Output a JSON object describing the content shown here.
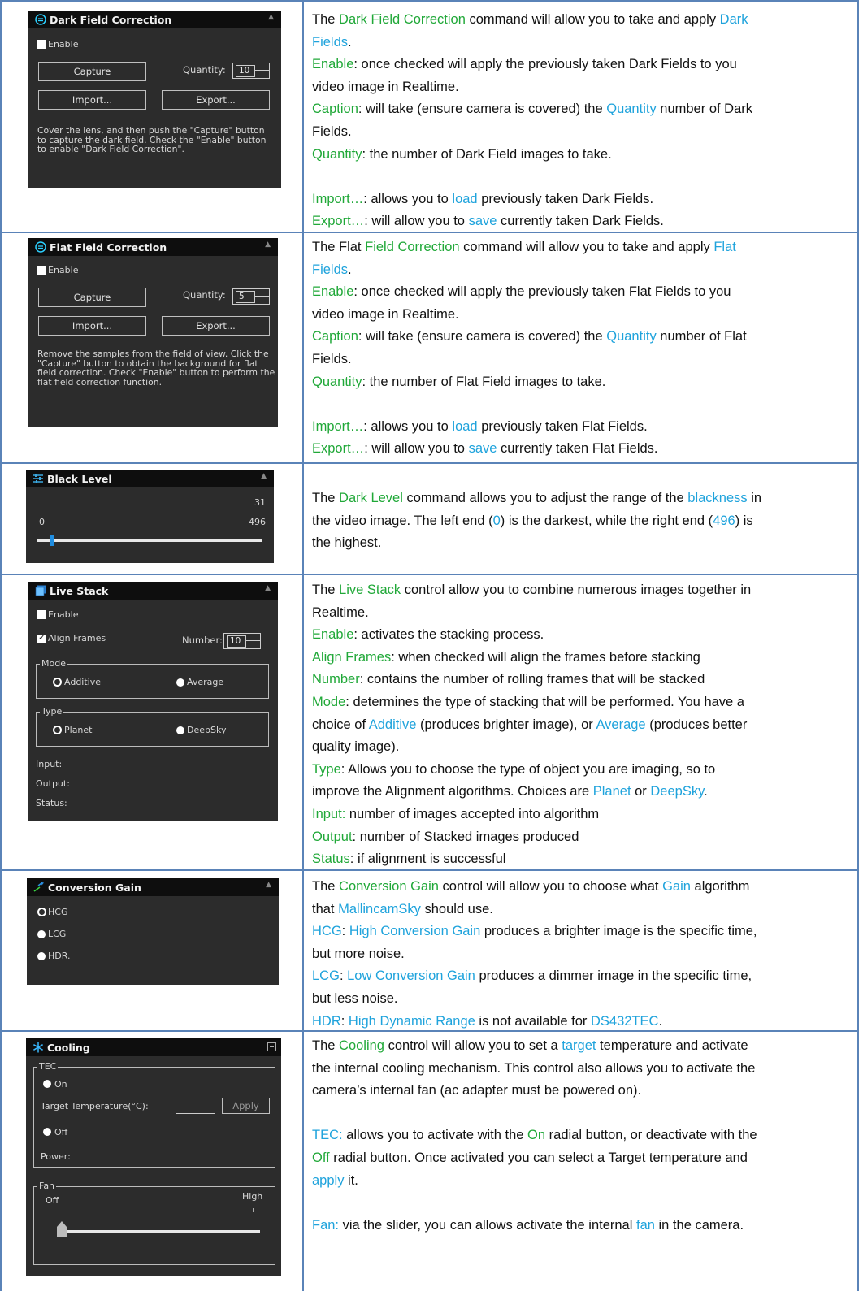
{
  "panels": {
    "dark": {
      "title": "Dark Field Correction",
      "enable_label": "Enable",
      "capture_label": "Capture",
      "quantity_label": "Quantity:",
      "quantity_value": "10",
      "import_label": "Import...",
      "export_label": "Export...",
      "help_lines": [
        "Cover the lens, and then push the \"Capture\" button",
        "to capture the dark field. Check the \"Enable\" button",
        "to enable \"Dark Field Correction\"."
      ]
    },
    "flat": {
      "title": "Flat Field Correction",
      "enable_label": "Enable",
      "capture_label": "Capture",
      "quantity_label": "Quantity:",
      "quantity_value": "5",
      "import_label": "Import...",
      "export_label": "Export...",
      "help_lines": [
        "Remove the samples from the field of view. Click the",
        "\"Capture\" button to obtain the background for flat",
        "field correction. Check \"Enable\" button to perform the",
        "flat field correction function."
      ]
    },
    "black": {
      "title": "Black Level",
      "current_value": "31",
      "min_label": "0",
      "max_label": "496",
      "level": 31
    },
    "stack": {
      "title": "Live Stack",
      "enable_label": "Enable",
      "align_label": "Align Frames",
      "number_label": "Number:",
      "number_value": "10",
      "mode_label": "Mode",
      "mode_opt1": "Additive",
      "mode_opt2": "Average",
      "type_label": "Type",
      "type_opt1": "Planet",
      "type_opt2": "DeepSky",
      "input_label": "Input:",
      "output_label": "Output:",
      "status_label": "Status:"
    },
    "gain": {
      "title": "Conversion Gain",
      "opt1": "HCG",
      "opt2": "LCG",
      "opt3": "HDR."
    },
    "cool": {
      "title": "Cooling",
      "tec_label": "TEC",
      "on_label": "On",
      "target_label": "Target Temperature(°C):",
      "apply_label": "Apply",
      "off_label": "Off",
      "power_label": "Power:",
      "fan_label": "Fan",
      "fan_off": "Off",
      "fan_high": "High",
      "fan_level": 0
    }
  },
  "descriptions": {
    "dark": [
      [
        [
          "The ",
          ""
        ],
        [
          "Dark Field Correction",
          "g"
        ],
        [
          " command will allow you to take and apply ",
          ""
        ],
        [
          "Dark",
          "b"
        ]
      ],
      [
        [
          "Fields",
          "b"
        ],
        [
          ".",
          ""
        ]
      ],
      [
        [
          "Enable",
          "g"
        ],
        [
          ": once checked will apply the previously taken Dark Fields to you",
          ""
        ]
      ],
      [
        [
          "video image in Realtime.",
          ""
        ]
      ],
      [
        [
          "Caption",
          "g"
        ],
        [
          ": will take (ensure camera is covered) the ",
          ""
        ],
        [
          "Quantity",
          "b"
        ],
        [
          " number of Dark",
          ""
        ]
      ],
      [
        [
          "Fields.",
          ""
        ]
      ],
      [
        [
          "Quantity",
          "g"
        ],
        [
          ": the number of Dark Field images to take.",
          ""
        ]
      ],
      [
        [
          "",
          ""
        ]
      ],
      [
        [
          "Import…",
          "g"
        ],
        [
          ": allows you to ",
          ""
        ],
        [
          "load",
          "b"
        ],
        [
          " previously taken Dark Fields.",
          ""
        ]
      ],
      [
        [
          "Export…",
          "g"
        ],
        [
          ": will allow you to ",
          ""
        ],
        [
          "save",
          "b"
        ],
        [
          " currently taken Dark Fields.",
          ""
        ]
      ]
    ],
    "flat": [
      [
        [
          "The Flat ",
          ""
        ],
        [
          "Field Correction",
          "g"
        ],
        [
          " command will allow you to take and apply ",
          ""
        ],
        [
          "Flat",
          "b"
        ]
      ],
      [
        [
          "Fields",
          "b"
        ],
        [
          ".",
          ""
        ]
      ],
      [
        [
          "Enable",
          "g"
        ],
        [
          ": once checked will apply the previously taken Flat Fields to you",
          ""
        ]
      ],
      [
        [
          "video image in Realtime.",
          ""
        ]
      ],
      [
        [
          "Caption",
          "g"
        ],
        [
          ": will take (ensure camera is covered) the ",
          ""
        ],
        [
          "Quantity",
          "b"
        ],
        [
          " number of Flat",
          ""
        ]
      ],
      [
        [
          "Fields.",
          ""
        ]
      ],
      [
        [
          "Quantity",
          "g"
        ],
        [
          ": the number of Flat Field images to take.",
          ""
        ]
      ],
      [
        [
          "",
          ""
        ]
      ],
      [
        [
          "Import…",
          "g"
        ],
        [
          ": allows you to ",
          ""
        ],
        [
          "load",
          "b"
        ],
        [
          " previously taken Flat Fields.",
          ""
        ]
      ],
      [
        [
          "Export…",
          "g"
        ],
        [
          ": will allow you to ",
          ""
        ],
        [
          "save",
          "b"
        ],
        [
          " currently taken Flat Fields.",
          ""
        ]
      ]
    ],
    "black": [
      [
        [
          "The ",
          ""
        ],
        [
          "Dark Level",
          "g"
        ],
        [
          " command allows you to adjust the range of the ",
          ""
        ],
        [
          "blackness",
          "b"
        ],
        [
          " in",
          ""
        ]
      ],
      [
        [
          "the video image. The left end (",
          ""
        ],
        [
          "0",
          "b"
        ],
        [
          ") is the darkest, while the right end (",
          ""
        ],
        [
          "496",
          "b"
        ],
        [
          ") is",
          ""
        ]
      ],
      [
        [
          "the highest.",
          ""
        ]
      ]
    ],
    "stack": [
      [
        [
          "The ",
          ""
        ],
        [
          "Live Stack",
          "g"
        ],
        [
          " control allow you to combine numerous images together in",
          ""
        ]
      ],
      [
        [
          "Realtime.",
          ""
        ]
      ],
      [
        [
          "Enable",
          "g"
        ],
        [
          ": activates the stacking process.",
          ""
        ]
      ],
      [
        [
          "Align Frames",
          "g"
        ],
        [
          ": when checked will align the frames before stacking",
          ""
        ]
      ],
      [
        [
          "Number",
          "g"
        ],
        [
          ": contains the number of rolling frames that will be stacked",
          ""
        ]
      ],
      [
        [
          "Mode",
          "g"
        ],
        [
          ": determines the type of stacking that will be performed. You have a",
          ""
        ]
      ],
      [
        [
          "choice of ",
          ""
        ],
        [
          "Additive",
          "b"
        ],
        [
          " (produces brighter image), or ",
          ""
        ],
        [
          "Average",
          "b"
        ],
        [
          " (produces better",
          ""
        ]
      ],
      [
        [
          "quality image).",
          ""
        ]
      ],
      [
        [
          "Type",
          "g"
        ],
        [
          ": Allows you to choose the type of object you are imaging, so to",
          ""
        ]
      ],
      [
        [
          "improve the Alignment algorithms. Choices are ",
          ""
        ],
        [
          "Planet",
          "b"
        ],
        [
          " or ",
          ""
        ],
        [
          "DeepSky",
          "b"
        ],
        [
          ".",
          ""
        ]
      ],
      [
        [
          "Input:",
          "g"
        ],
        [
          " number of images accepted into algorithm",
          ""
        ]
      ],
      [
        [
          "Output",
          "g"
        ],
        [
          ": number of Stacked images produced",
          ""
        ]
      ],
      [
        [
          "Status",
          "g"
        ],
        [
          ": if alignment is successful",
          ""
        ]
      ]
    ],
    "gain": [
      [
        [
          "The ",
          ""
        ],
        [
          "Conversion Gain",
          "g"
        ],
        [
          " control will allow you to choose what ",
          ""
        ],
        [
          "Gain",
          "b"
        ],
        [
          " algorithm",
          ""
        ]
      ],
      [
        [
          "that ",
          ""
        ],
        [
          "MallincamSky",
          "b"
        ],
        [
          " should use.",
          ""
        ]
      ],
      [
        [
          "HCG",
          "b"
        ],
        [
          ": ",
          ""
        ],
        [
          "High Conversion Gain",
          "b"
        ],
        [
          " produces a brighter image is the specific time,",
          ""
        ]
      ],
      [
        [
          "but more noise.",
          ""
        ]
      ],
      [
        [
          "LCG",
          "b"
        ],
        [
          ": ",
          ""
        ],
        [
          "Low Conversion Gain",
          "b"
        ],
        [
          " produces a dimmer image in the specific time,",
          ""
        ]
      ],
      [
        [
          "but less noise.",
          ""
        ]
      ],
      [
        [
          "HDR",
          "b"
        ],
        [
          ": ",
          ""
        ],
        [
          "High Dynamic Range",
          "b"
        ],
        [
          " is not available for ",
          ""
        ],
        [
          "DS432TEC",
          "b"
        ],
        [
          ".",
          ""
        ]
      ]
    ],
    "cool": [
      [
        [
          "The ",
          ""
        ],
        [
          "Cooling",
          "g"
        ],
        [
          " control will allow you to set a ",
          ""
        ],
        [
          "target",
          "b"
        ],
        [
          " temperature and activate",
          ""
        ]
      ],
      [
        [
          "the internal cooling mechanism. This control also allows you to activate the",
          ""
        ]
      ],
      [
        [
          "camera’s internal fan (ac adapter must be powered on).",
          ""
        ]
      ],
      [
        [
          "",
          ""
        ]
      ],
      [
        [
          "TEC:",
          "b"
        ],
        [
          " allows you to activate with the ",
          ""
        ],
        [
          "On",
          "g"
        ],
        [
          " radial button, or deactivate with the",
          ""
        ]
      ],
      [
        [
          "Off",
          "g"
        ],
        [
          " radial button. Once activated you can select a Target temperature and",
          ""
        ]
      ],
      [
        [
          "apply",
          "b"
        ],
        [
          " it.",
          ""
        ]
      ],
      [
        [
          "",
          ""
        ]
      ],
      [
        [
          "Fan:",
          "b"
        ],
        [
          " via the slider, you can allows activate the internal ",
          ""
        ],
        [
          "fan",
          "b"
        ],
        [
          " in the camera.",
          ""
        ]
      ]
    ]
  }
}
